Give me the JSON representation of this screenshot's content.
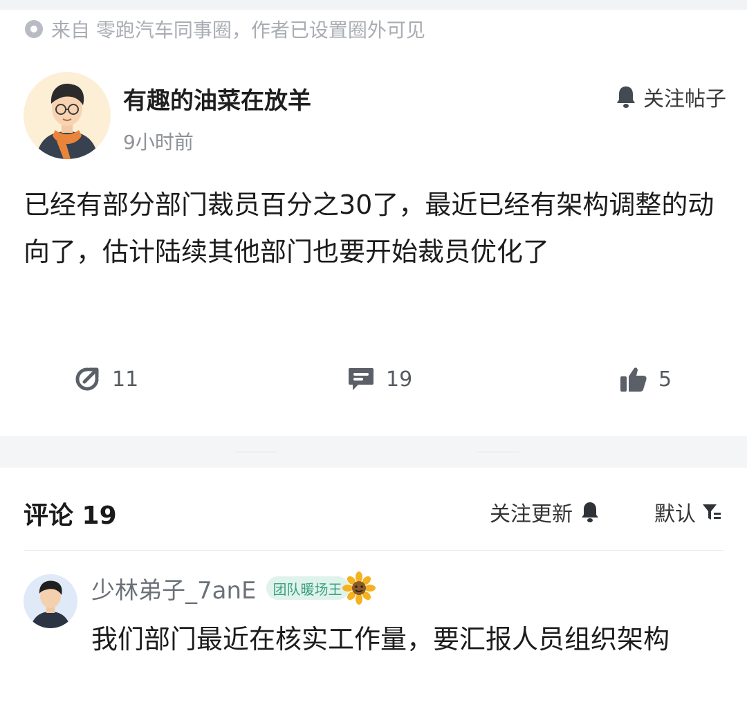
{
  "source": {
    "text": "来自 零跑汽车同事圈，作者已设置圈外可见",
    "icon": "visibility-circle-icon"
  },
  "post": {
    "author": "有趣的油菜在放羊",
    "time": "9小时前",
    "follow_label": "关注帖子",
    "body": "已经有部分部门裁员百分之30了，最近已经有架构调整的动向了，估计陆续其他部门也要开始裁员优化了",
    "stats": {
      "shares": "11",
      "comments": "19",
      "likes": "5"
    }
  },
  "comments_header": {
    "title": "评论 19",
    "follow_updates": "关注更新",
    "sort": "默认"
  },
  "comments": [
    {
      "user": "少林弟子_7anE",
      "badge": "团队暖场王",
      "text": "我们部门最近在核实工作量，要汇报人员组织架构"
    }
  ],
  "colors": {
    "muted": "#a9adb3",
    "badge_bg": "#dff3ec",
    "badge_text": "#3b9f7f",
    "separator": "#f4f5f7"
  }
}
